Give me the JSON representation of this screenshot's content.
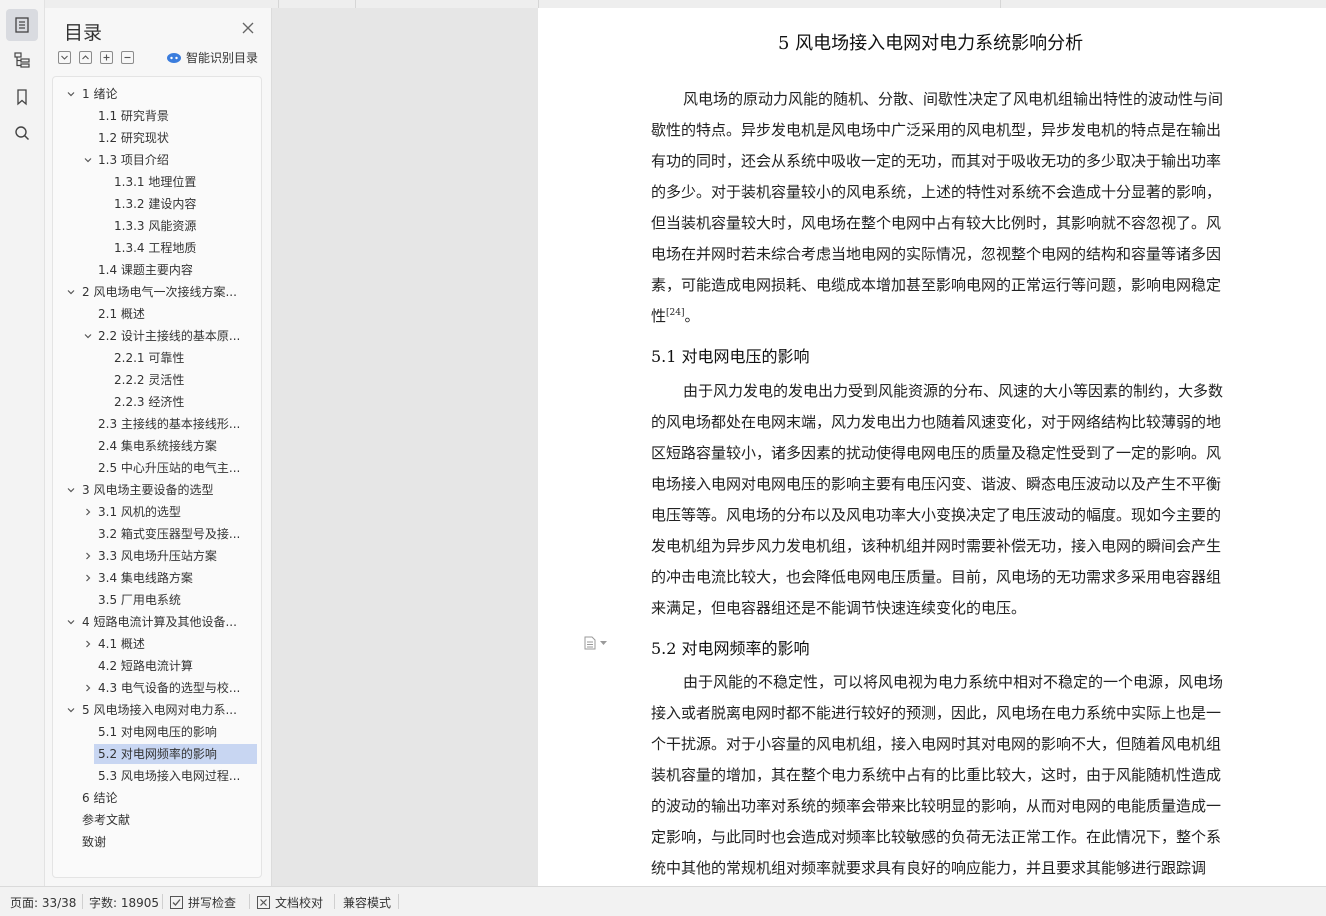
{
  "toc": {
    "title": "目录",
    "smart_label": "智能识别目录",
    "items": [
      {
        "label": "1   绪论",
        "level": 1,
        "toggle": "expanded"
      },
      {
        "label": "1.1  研究背景",
        "level": 2,
        "toggle": "none"
      },
      {
        "label": "1.2  研究现状",
        "level": 2,
        "toggle": "none"
      },
      {
        "label": "1.3  项目介绍",
        "level": 2,
        "toggle": "expanded"
      },
      {
        "label": "1.3.1  地理位置",
        "level": 3,
        "toggle": "none"
      },
      {
        "label": "1.3.2  建设内容",
        "level": 3,
        "toggle": "none"
      },
      {
        "label": "1.3.3  风能资源",
        "level": 3,
        "toggle": "none"
      },
      {
        "label": "1.3.4  工程地质",
        "level": 3,
        "toggle": "none"
      },
      {
        "label": "1.4  课题主要内容",
        "level": 2,
        "toggle": "none"
      },
      {
        "label": "2   风电场电气一次接线方案...",
        "level": 1,
        "toggle": "expanded"
      },
      {
        "label": "2.1  概述",
        "level": 2,
        "toggle": "none"
      },
      {
        "label": "2.2  设计主接线的基本原...",
        "level": 2,
        "toggle": "expanded"
      },
      {
        "label": "2.2.1  可靠性",
        "level": 3,
        "toggle": "none"
      },
      {
        "label": "2.2.2  灵活性",
        "level": 3,
        "toggle": "none"
      },
      {
        "label": "2.2.3  经济性",
        "level": 3,
        "toggle": "none"
      },
      {
        "label": "2.3  主接线的基本接线形...",
        "level": 2,
        "toggle": "none"
      },
      {
        "label": "2.4  集电系统接线方案",
        "level": 2,
        "toggle": "none"
      },
      {
        "label": "2.5  中心升压站的电气主...",
        "level": 2,
        "toggle": "none"
      },
      {
        "label": "3   风电场主要设备的选型",
        "level": 1,
        "toggle": "expanded"
      },
      {
        "label": "3.1  风机的选型",
        "level": 2,
        "toggle": "collapsed"
      },
      {
        "label": "3.2  箱式变压器型号及接...",
        "level": 2,
        "toggle": "none"
      },
      {
        "label": "3.3  风电场升压站方案",
        "level": 2,
        "toggle": "collapsed"
      },
      {
        "label": "3.4  集电线路方案",
        "level": 2,
        "toggle": "collapsed"
      },
      {
        "label": "3.5  厂用电系统",
        "level": 2,
        "toggle": "none"
      },
      {
        "label": "4   短路电流计算及其他设备...",
        "level": 1,
        "toggle": "expanded"
      },
      {
        "label": "4.1  概述",
        "level": 2,
        "toggle": "collapsed"
      },
      {
        "label": "4.2  短路电流计算",
        "level": 2,
        "toggle": "none"
      },
      {
        "label": "4.3  电气设备的选型与校...",
        "level": 2,
        "toggle": "collapsed"
      },
      {
        "label": "5   风电场接入电网对电力系...",
        "level": 1,
        "toggle": "expanded"
      },
      {
        "label": "5.1  对电网电压的影响",
        "level": 2,
        "toggle": "none"
      },
      {
        "label": "5.2  对电网频率的影响",
        "level": 2,
        "toggle": "none",
        "selected": true
      },
      {
        "label": "5.3  风电场接入电网过程...",
        "level": 2,
        "toggle": "none"
      },
      {
        "label": "6   结论",
        "level": 1,
        "toggle": "none"
      },
      {
        "label": "参考文献",
        "level": 0,
        "toggle": "none"
      },
      {
        "label": "致谢",
        "level": 0,
        "toggle": "none"
      }
    ]
  },
  "document": {
    "heading": "5    风电场接入电网对电力系统影响分析",
    "para1": [
      "风电场的原动力风能的随机、分散、间歇性决定了风电机组输出特性的波动性与间",
      "歇性的特点。异步发电机是风电场中广泛采用的风电机型，异步发电机的特点是在输出",
      "有功的同时，还会从系统中吸收一定的无功，而其对于吸收无功的多少取决于输出功率",
      "的多少。对于装机容量较小的风电系统，上述的特性对系统不会造成十分显著的影响，",
      "但当装机容量较大时，风电场在整个电网中占有较大比例时，其影响就不容忽视了。风",
      "电场在并网时若未综合考虑当地电网的实际情况，忽视整个电网的结构和容量等诸多因",
      "素，可能造成电网损耗、电缆成本增加甚至影响电网的正常运行等问题，影响电网稳定"
    ],
    "para1_end": "性",
    "citation": "[24]",
    "para1_tail": "。",
    "section1": "5.1  对电网电压的影响",
    "para2": [
      "由于风力发电的发电出力受到风能资源的分布、风速的大小等因素的制约，大多数",
      "的风电场都处在电网末端，风力发电出力也随着风速变化，对于网络结构比较薄弱的地",
      "区短路容量较小，诸多因素的扰动使得电网电压的质量及稳定性受到了一定的影响。风",
      "电场接入电网对电网电压的影响主要有电压闪变、谐波、瞬态电压波动以及产生不平衡",
      "电压等等。风电场的分布以及风电功率大小变换决定了电压波动的幅度。现如今主要的",
      "发电机组为异步风力发电机组，该种机组并网时需要补偿无功，接入电网的瞬间会产生",
      "的冲击电流比较大，也会降低电网电压质量。目前，风电场的无功需求多采用电容器组",
      "来满足，但电容器组还是不能调节快速连续变化的电压。"
    ],
    "section2": "5.2  对电网频率的影响",
    "para3": [
      "由于风能的不稳定性，可以将风电视为电力系统中相对不稳定的一个电源，风电场",
      "接入或者脱离电网时都不能进行较好的预测，因此，风电场在电力系统中实际上也是一",
      "个干扰源。对于小容量的风电机组，接入电网时其对电网的影响不大，但随着风电机组",
      "装机容量的增加，其在整个电力系统中占有的比重比较大，这时，由于风能随机性造成",
      "的波动的输出功率对系统的频率会带来比较明显的影响，从而对电网的电能质量造成一",
      "定影响，与此同时也会造成对频率比较敏感的负荷无法正常工作。在此情况下，整个系",
      "统中其他的常规机组对频率就要求具有良好的响应能力，并且要求其能够进行跟踪调"
    ]
  },
  "status": {
    "page": "页面: 33/38",
    "words": "字数: 18905",
    "spell": "拼写检查",
    "proof": "文档校对",
    "compat": "兼容模式"
  },
  "colors": {
    "selection": "#c8d6f2",
    "accent": "#3b7ddd"
  }
}
